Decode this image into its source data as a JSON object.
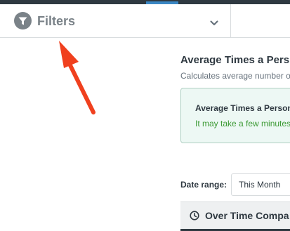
{
  "filters": {
    "label": "Filters",
    "icon": "filter-icon",
    "chevron_icon": "chevron-down-icon"
  },
  "report": {
    "title": "Average Times a Pers",
    "description": "Calculates average number o"
  },
  "notice": {
    "title": "Average Times a Person",
    "text": "It may take a few minutes"
  },
  "date_range": {
    "label": "Date range:",
    "selected": "This Month"
  },
  "panel": {
    "icon": "clock-icon",
    "title": "Over Time Compa"
  },
  "annotation": {
    "arrow_color": "#f0401e"
  },
  "colors": {
    "header_dark": "#2f3941",
    "accent_blue": "#3b87c4",
    "notice_green": "#3c9a34"
  }
}
